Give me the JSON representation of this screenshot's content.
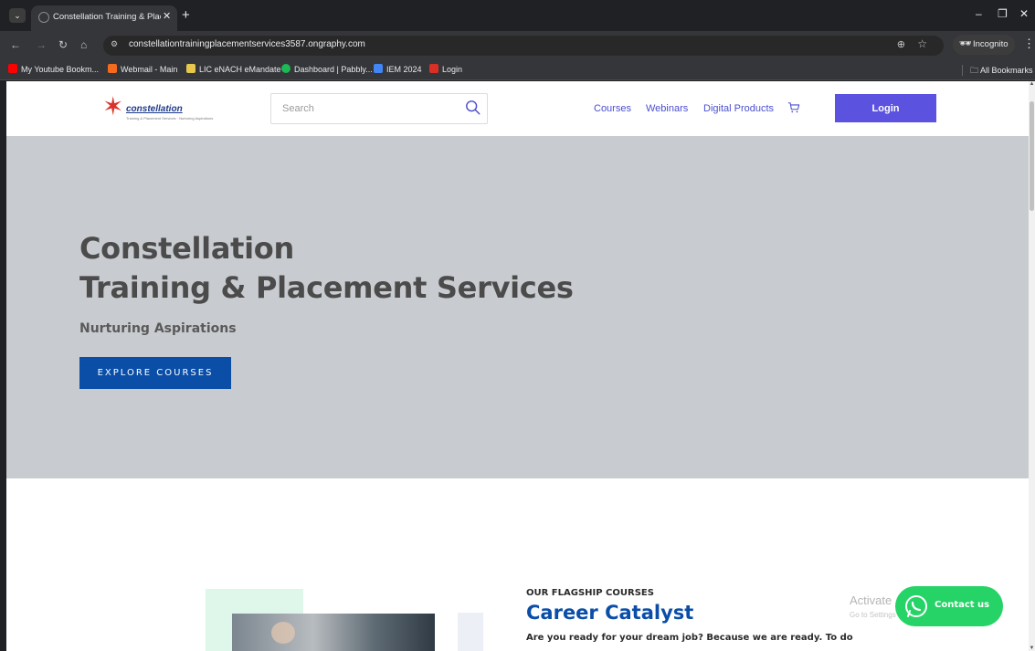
{
  "browser": {
    "tab_title": "Constellation Training & Placem",
    "url": "constellationtrainingplacementservices3587.ongraphy.com",
    "incognito_label": "Incognito",
    "bookmarks": [
      {
        "label": "My Youtube Bookm...",
        "icon": "youtube-icon",
        "color": "#ff0000"
      },
      {
        "label": "Webmail - Main",
        "icon": "webmail-icon",
        "color": "#f46b1e"
      },
      {
        "label": "LIC eNACH eMandate",
        "icon": "lic-icon",
        "color": "#e7c84d"
      },
      {
        "label": "Dashboard | Pabbly...",
        "icon": "pabbly-icon",
        "color": "#1db954"
      },
      {
        "label": "IEM 2024",
        "icon": "drive-icon",
        "color": "#4285f4"
      },
      {
        "label": "Login",
        "icon": "login-bookmark-icon",
        "color": "#d93025"
      }
    ],
    "all_bookmarks_label": "All Bookmarks"
  },
  "header": {
    "logo_text": "constellation",
    "logo_tagline": "Training & Placement Services · Nurturing Aspirations",
    "search_placeholder": "Search",
    "nav": [
      "Courses",
      "Webinars",
      "Digital Products"
    ],
    "login_label": "Login"
  },
  "hero": {
    "title_line1": "Constellation",
    "title_line2": "Training & Placement Services",
    "subtitle": "Nurturing Aspirations",
    "cta_label": "EXPLORE COURSES"
  },
  "flagship": {
    "label": "OUR FLAGSHIP COURSES",
    "title": "Career Catalyst",
    "description": "Are you ready for your dream job? Because we are ready. To do"
  },
  "watermark": {
    "line1": "Activate",
    "line2": "Go to Settings to activate Windows."
  },
  "contact": {
    "label": "Contact us"
  },
  "colors": {
    "brand_primary": "#0a4ea8",
    "login_button": "#5b52e0",
    "nav_link": "#4b4ecf",
    "hero_bg": "#c8cbcf",
    "whatsapp": "#25d366"
  }
}
